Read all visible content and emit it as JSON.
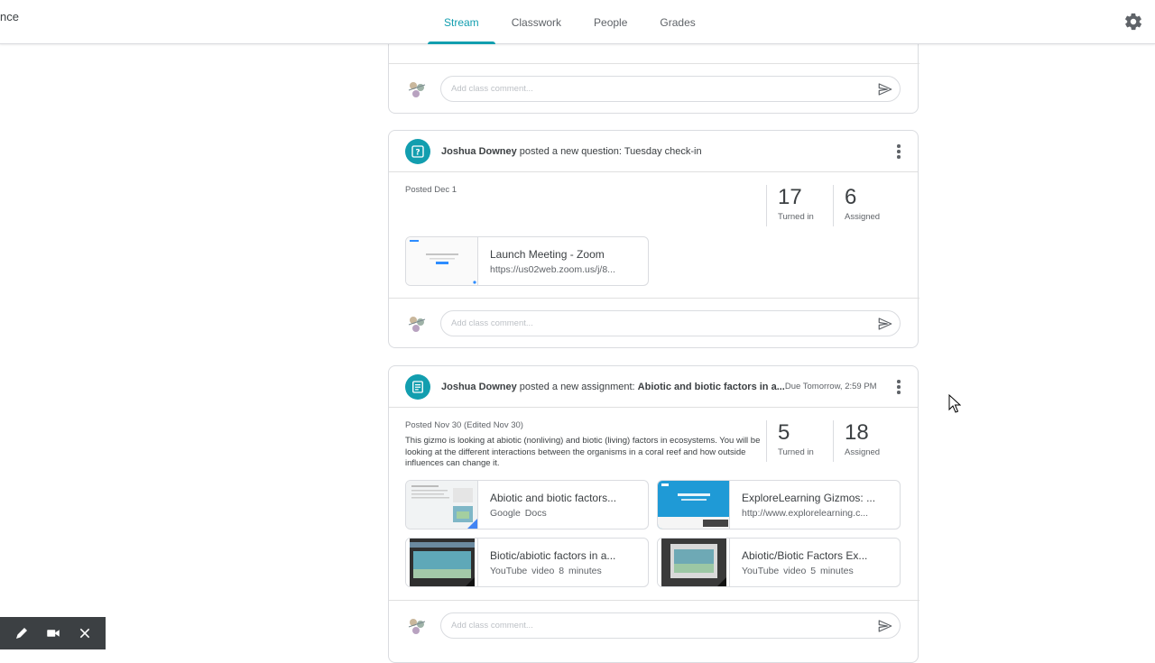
{
  "app": {
    "brand_fragment": "nce"
  },
  "tabs": [
    {
      "label": "Stream",
      "active": true
    },
    {
      "label": "Classwork"
    },
    {
      "label": "People"
    },
    {
      "label": "Grades"
    }
  ],
  "icons": {
    "settings": "gear-icon",
    "more": "more-vert-icon",
    "send": "send-icon",
    "question": "question-icon",
    "assignment": "assignment-icon"
  },
  "colors": {
    "accent": "#129eaf",
    "border": "#dadce0",
    "text": "#3c4043",
    "muted": "#5f6368"
  },
  "comment_placeholder": "Add class comment...",
  "posts": [
    {
      "author": "Joshua Downey",
      "action": " posted a new question: ",
      "title": "Tuesday check-in",
      "posted": "Posted Dec 1",
      "stats": [
        {
          "num": "17",
          "label": "Turned in"
        },
        {
          "num": "6",
          "label": "Assigned"
        }
      ],
      "attachments": [
        {
          "title": "Launch Meeting - Zoom",
          "sub": "https://us02web.zoom.us/j/8..."
        }
      ]
    },
    {
      "author": "Joshua Downey",
      "action": " posted a new assignment: ",
      "title": "Abiotic and biotic factors in a...",
      "due": "Due Tomorrow, 2:59 PM",
      "posted": "Posted Nov 30 (Edited Nov 30)",
      "description": "This gizmo is looking at abiotic (nonliving) and biotic (living) factors in ecosystems.  You will be looking at the different interactions between the organisms in a coral reef and how outside influences can change it.",
      "stats": [
        {
          "num": "5",
          "label": "Turned in"
        },
        {
          "num": "18",
          "label": "Assigned"
        }
      ],
      "attachments": [
        {
          "title": "Abiotic and biotic factors...",
          "sub": "Google Docs"
        },
        {
          "title": "ExploreLearning Gizmos: ...",
          "sub": "http://www.explorelearning.c..."
        },
        {
          "title": "Biotic/abiotic factors in a...",
          "sub": "YouTube video   8 minutes"
        },
        {
          "title": "Abiotic/Biotic Factors Ex...",
          "sub": "YouTube video   5 minutes"
        }
      ]
    }
  ]
}
